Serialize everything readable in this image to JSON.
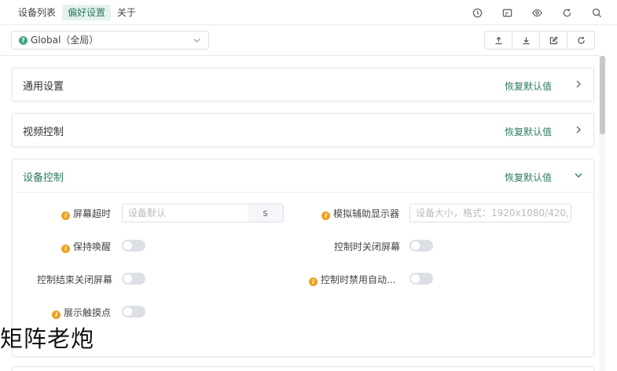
{
  "tabs": [
    {
      "label": "设备列表",
      "active": false
    },
    {
      "label": "偏好设置",
      "active": true
    },
    {
      "label": "关于",
      "active": false
    }
  ],
  "top_icons": [
    "clock-icon",
    "screen-cast-icon",
    "eye-icon",
    "refresh-icon",
    "search-icon"
  ],
  "scope_select": {
    "value": "Global（全局）",
    "icon": "question-icon"
  },
  "actions": [
    "upload-icon",
    "download-icon",
    "edit-icon",
    "reset-icon"
  ],
  "panels": [
    {
      "title": "通用设置",
      "reset": "恢复默认值",
      "expanded": false
    },
    {
      "title": "视频控制",
      "reset": "恢复默认值",
      "expanded": false
    },
    {
      "title": "设备控制",
      "reset": "恢复默认值",
      "expanded": true
    }
  ],
  "device_control": {
    "screen_timeout": {
      "label": "屏幕超时",
      "placeholder": "设备默认",
      "unit": "s"
    },
    "virtual_display": {
      "label": "模拟辅助显示器",
      "placeholder": "设备大小，格式：1920x1080/420,"
    },
    "stay_awake": {
      "label": "保持唤醒",
      "on": false
    },
    "turn_screen_off": {
      "label": "控制时关闭屏幕",
      "on": false
    },
    "power_off_on_close": {
      "label": "控制结束关闭屏幕",
      "on": false
    },
    "disable_auto": {
      "label": "控制时禁用自动...",
      "on": false
    },
    "show_touches": {
      "label": "展示触摸点",
      "on": false
    }
  },
  "watermark": "矩阵老炮",
  "colors": {
    "accent": "#2a7a62",
    "accent_bg": "#e6f2ee",
    "info": "#f0a020"
  }
}
